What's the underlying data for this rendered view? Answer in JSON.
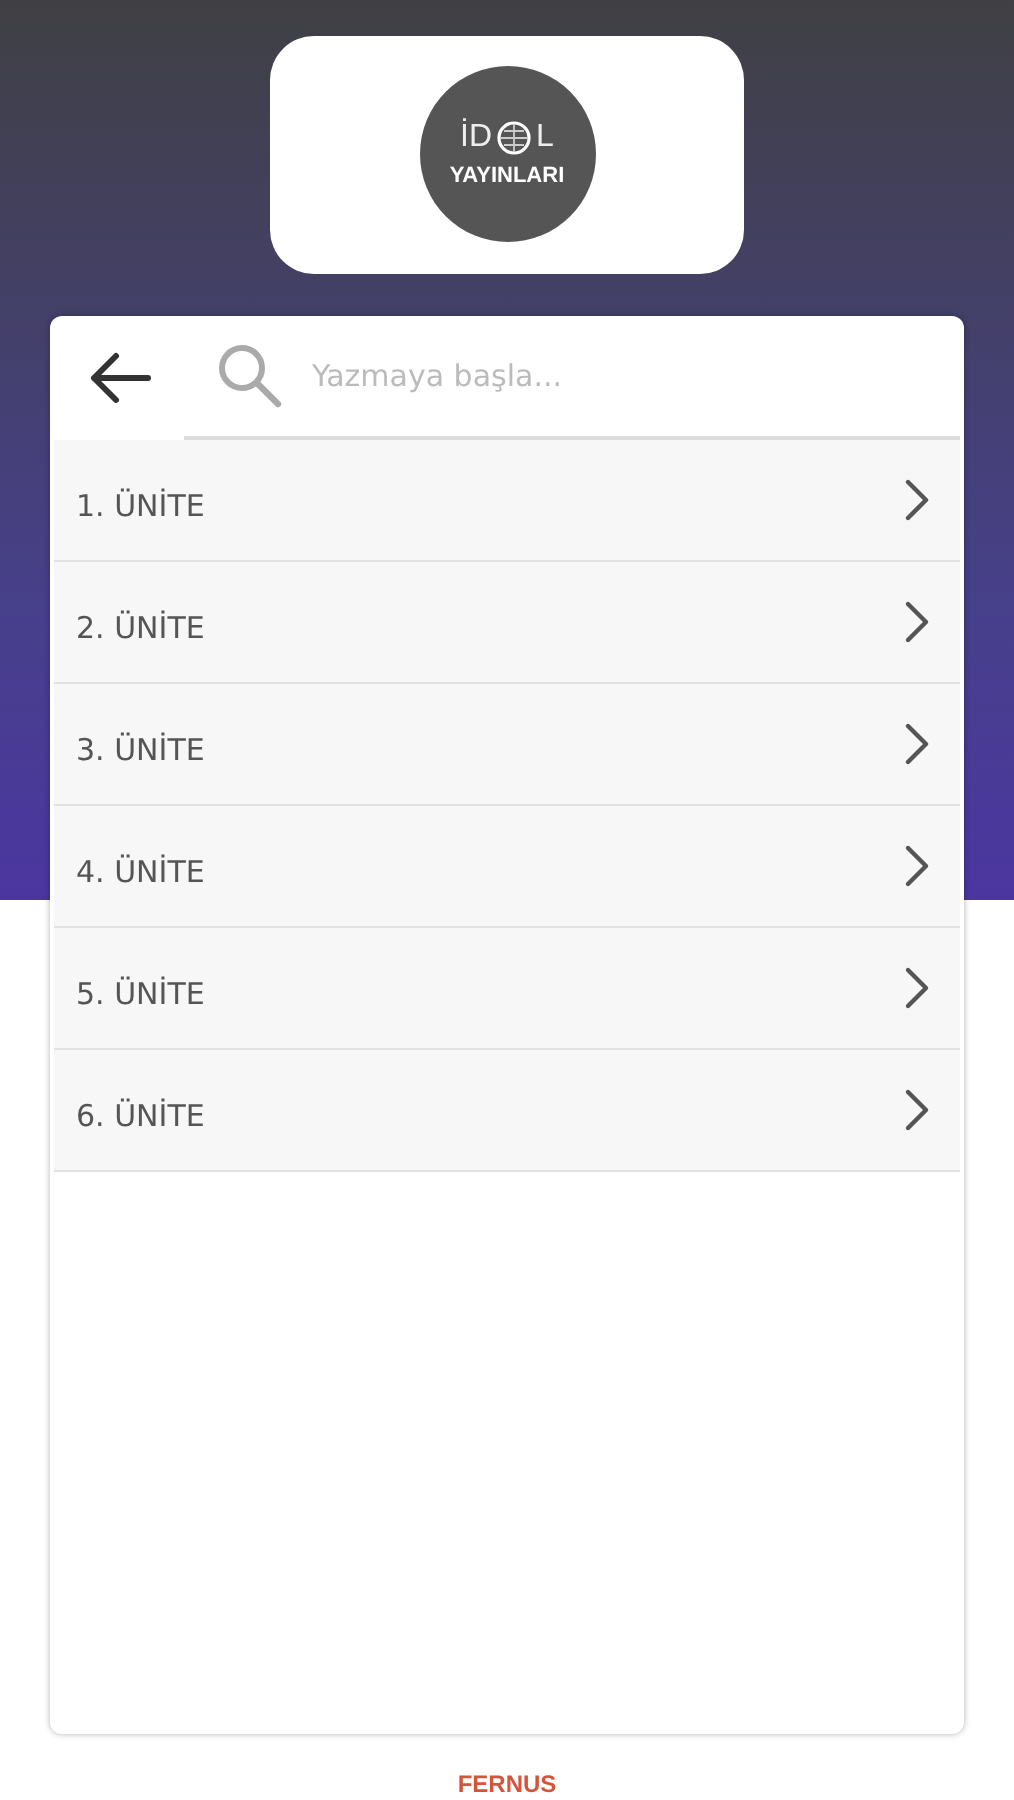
{
  "logo": {
    "text_left": "İD",
    "text_right": "L",
    "text_bottom": "YAYINLARI"
  },
  "search": {
    "placeholder": "Yazmaya başla..."
  },
  "units": [
    {
      "label": "1. ÜNİTE"
    },
    {
      "label": "2. ÜNİTE"
    },
    {
      "label": "3. ÜNİTE"
    },
    {
      "label": "4. ÜNİTE"
    },
    {
      "label": "5. ÜNİTE"
    },
    {
      "label": "6. ÜNİTE"
    }
  ],
  "footer": {
    "brand": "FERNUS"
  }
}
